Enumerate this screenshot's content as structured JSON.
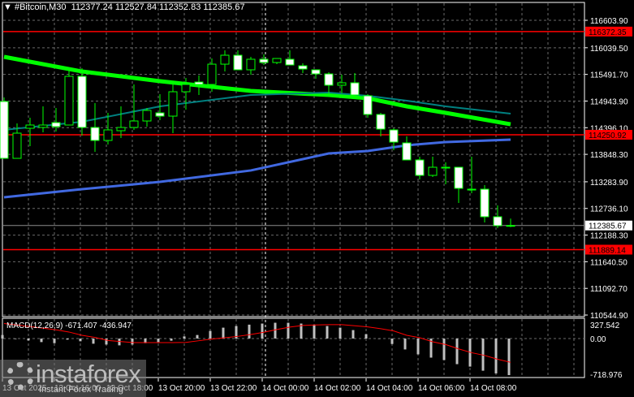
{
  "header": {
    "symbol": "#Bitcoin,M30",
    "ohlc": "112377.24 112527.84 112352.83 112385.67"
  },
  "colors": {
    "bg": "#000000",
    "candle_border": "#00ff00",
    "bear_body": "#ffffff",
    "ma_fast": "#00ff00",
    "ma_mid": "#008080",
    "ma_slow": "#4169e1",
    "level": "#ff0000",
    "macd_hist": "#c0c0c0",
    "macd_signal": "#ff0000"
  },
  "chart_data": {
    "type": "candlestick",
    "price_ticks": [
      "116603.90",
      "116039.50",
      "115491.70",
      "114943.90",
      "114396.10",
      "113848.30",
      "113283.90",
      "112736.10",
      "112188.30",
      "111640.50",
      "111092.70",
      "110544.90"
    ],
    "levels": [
      {
        "price": 116372.35,
        "label": "116372.35"
      },
      {
        "price": 114250.92,
        "label": "114250.92"
      },
      {
        "price": 111889.14,
        "label": "111889.14"
      }
    ],
    "current_price": {
      "price": 112385.67,
      "label": "112385.67"
    },
    "time_labels": [
      {
        "index": 0,
        "label": "13 Oct 2025"
      },
      {
        "index": 4,
        "label": "13 Oct 16:00"
      },
      {
        "index": 8,
        "label": "13 Oct 18:00"
      },
      {
        "index": 12,
        "label": "13 Oct 20:00"
      },
      {
        "index": 16,
        "label": "13 Oct 22:00"
      },
      {
        "index": 20,
        "label": "14 Oct 00:00"
      },
      {
        "index": 24,
        "label": "14 Oct 02:00"
      },
      {
        "index": 28,
        "label": "14 Oct 04:00"
      },
      {
        "index": 32,
        "label": "14 Oct 06:00"
      },
      {
        "index": 36,
        "label": "14 Oct 08:00"
      }
    ],
    "day_separator_index": 20,
    "candles": [
      [
        114935,
        115018,
        113766,
        113766
      ],
      [
        113766,
        114484,
        113766,
        114284
      ],
      [
        114384,
        114601,
        114017,
        114451
      ],
      [
        114401,
        114835,
        114301,
        114451
      ],
      [
        114501,
        114801,
        114317,
        114417
      ],
      [
        114451,
        115619,
        114451,
        115452
      ],
      [
        115452,
        115619,
        114234,
        114401
      ],
      [
        114401,
        114901,
        113900,
        114134
      ],
      [
        114134,
        114701,
        114050,
        114351
      ],
      [
        114334,
        114835,
        114184,
        114401
      ],
      [
        114401,
        115285,
        114351,
        114534
      ],
      [
        114534,
        114801,
        114417,
        114751
      ],
      [
        114701,
        115085,
        114551,
        114634
      ],
      [
        114634,
        115300,
        114284,
        115135
      ],
      [
        115135,
        115419,
        114768,
        115285
      ],
      [
        115335,
        115469,
        115068,
        115285
      ],
      [
        115285,
        115819,
        115135,
        115702
      ],
      [
        115702,
        115986,
        115552,
        115886
      ],
      [
        115886,
        115986,
        115586,
        115586
      ],
      [
        115586,
        115853,
        115486,
        115803
      ],
      [
        115803,
        115903,
        115686,
        115736
      ],
      [
        115736,
        115819,
        115702,
        115819
      ],
      [
        115803,
        115986,
        115686,
        115686
      ],
      [
        115669,
        115719,
        115519,
        115602
      ],
      [
        115586,
        115586,
        115402,
        115502
      ],
      [
        115502,
        115536,
        115102,
        115269
      ],
      [
        115269,
        115486,
        115102,
        115319
      ],
      [
        115319,
        115519,
        114985,
        115068
      ],
      [
        115052,
        115085,
        114601,
        114668
      ],
      [
        114668,
        114701,
        114217,
        114367
      ],
      [
        114351,
        114384,
        113933,
        114100
      ],
      [
        114084,
        114217,
        113733,
        113733
      ],
      [
        113733,
        113800,
        113333,
        113416
      ],
      [
        113416,
        113800,
        113383,
        113583
      ],
      [
        113583,
        113683,
        113232,
        113583
      ],
      [
        113583,
        113583,
        112848,
        113149
      ],
      [
        113132,
        113800,
        113049,
        113132
      ],
      [
        113132,
        113216,
        112448,
        112565
      ],
      [
        112565,
        112798,
        112331,
        112381
      ],
      [
        112377.24,
        112527.84,
        112352.83,
        112385.67
      ]
    ],
    "moving_averages": [
      {
        "name": "ma_fast",
        "points": [
          [
            0,
            115853
          ],
          [
            6,
            115552
          ],
          [
            12,
            115352
          ],
          [
            19,
            115152
          ],
          [
            25,
            115068
          ],
          [
            28,
            115002
          ],
          [
            31,
            114835
          ],
          [
            34,
            114701
          ],
          [
            39,
            114467
          ]
        ]
      },
      {
        "name": "ma_mid",
        "points": [
          [
            0,
            114351
          ],
          [
            6,
            114518
          ],
          [
            12,
            114835
          ],
          [
            19,
            115068
          ],
          [
            25,
            115119
          ],
          [
            28,
            115052
          ],
          [
            31,
            114951
          ],
          [
            34,
            114835
          ],
          [
            39,
            114684
          ]
        ]
      },
      {
        "name": "ma_slow",
        "points": [
          [
            0,
            112966
          ],
          [
            6,
            113132
          ],
          [
            12,
            113283
          ],
          [
            19,
            113517
          ],
          [
            25,
            113866
          ],
          [
            28,
            113917
          ],
          [
            31,
            114034
          ],
          [
            34,
            114100
          ],
          [
            39,
            114150
          ]
        ]
      }
    ],
    "macd": {
      "label": "MACD(12,26,9) -671.407 -436.947",
      "ticks": [
        "327.542",
        "0.00",
        "-718.976"
      ],
      "histogram": [
        65,
        -10,
        -35,
        -65,
        -85,
        -20,
        -50,
        -95,
        -110,
        -125,
        -110,
        -85,
        -65,
        -40,
        40,
        65,
        140,
        200,
        230,
        255,
        275,
        290,
        290,
        275,
        255,
        230,
        200,
        155,
        80,
        0,
        -100,
        -200,
        -290,
        -350,
        -395,
        -470,
        -515,
        -590,
        -640,
        -671.4
      ],
      "signal": [
        275,
        250,
        220,
        190,
        160,
        120,
        60,
        20,
        -35,
        -55,
        -75,
        -75,
        -75,
        -75,
        -70,
        -40,
        -10,
        15,
        40,
        75,
        115,
        165,
        210,
        240,
        250,
        255,
        255,
        235,
        215,
        180,
        140,
        60,
        15,
        -60,
        -110,
        -190,
        -260,
        -310,
        -380,
        -436.9
      ]
    }
  },
  "watermark": {
    "brand": "instaforex",
    "tagline": "Instant Forex Trading"
  }
}
